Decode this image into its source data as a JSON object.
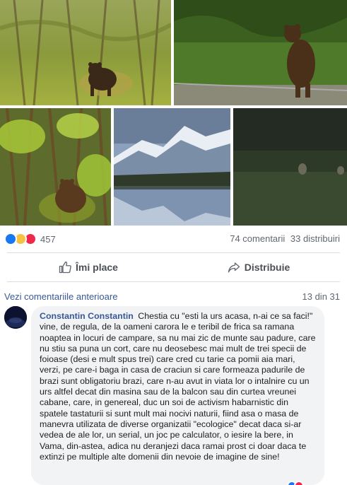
{
  "photos": {
    "items": [
      {
        "icon": "bear-in-forest-photo"
      },
      {
        "icon": "bear-standing-roadside-photo"
      },
      {
        "icon": "bear-behind-leaves-photo"
      },
      {
        "icon": "snowy-mountains-lake-photo"
      },
      {
        "icon": "night-camera-animals-photo"
      }
    ]
  },
  "reactions": {
    "types": [
      "like",
      "wow",
      "love"
    ],
    "colors": {
      "like": "#1877f2",
      "wow": "#f7c242",
      "love": "#f0284a"
    },
    "count": "457",
    "comments": "74 comentarii",
    "shares": "33 distribuiri"
  },
  "actions": {
    "like_label": "Îmi place",
    "share_label": "Distribuie"
  },
  "comments_section": {
    "view_previous": "Vezi comentariile anterioare",
    "counter": "13 din 31"
  },
  "comment": {
    "author": "Constantin Constantin",
    "text": "Chestia cu \"esti la urs acasa, n-ai ce sa faci!\" vine, de regula, de la oameni carora le e teribil de frica sa ramana noaptea in locuri de campare, sa nu mai zic de munte sau padure, care nu stiu sa puna un cort, care nu deosebesc mai mult de trei specii de foioase (desi e mult spus trei) care cred cu tarie ca pomii aia mari, verzi, pe care-i baga in casa de craciun si care formeaza padurile de brazi sunt obligatoriu brazi, care n-au avut in viata lor o intalnire cu un urs altfel decat din masina sau de la balcon sau din curtea vreunei cabane, care, in genereal, duc un soi de activism habarnistic din spatele tastaturii si sunt mult mai nocivi naturii, fiind asa o masa de manevra utilizata de diverse organizatii \"ecologice\" decat daca si-ar vedea de ale lor, un serial, un joc pe calculator, o iesire la bere, in Vama, din-astea, adica nu deranjezi daca ramai prost ci doar daca te extinzi pe multiple alte domenii din nevoie de imagine de sine!"
  },
  "colors": {
    "link": "#385898",
    "muted": "#606770",
    "bubble": "#f2f3f5"
  }
}
